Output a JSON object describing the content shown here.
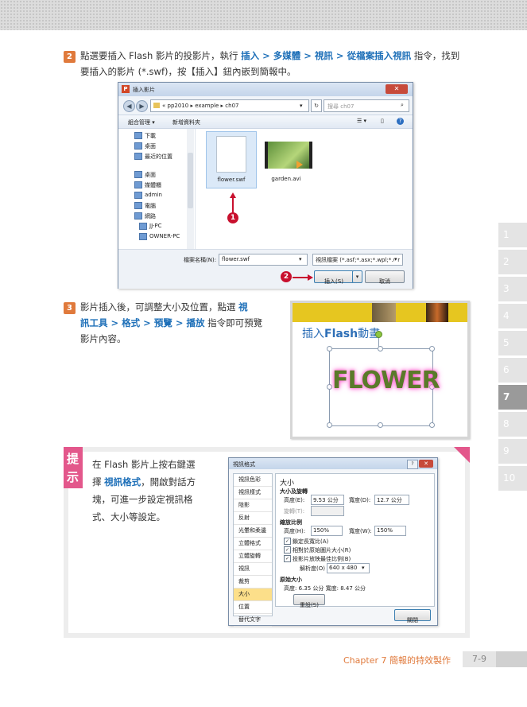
{
  "step2": {
    "number": "2",
    "t1": "點選要插入 Flash 影片的投影片，執行 ",
    "k1": "插入",
    "sep1": " > ",
    "k2": "多媒體",
    "sep2": " > ",
    "k3": "視訊",
    "sep3": " > ",
    "k4": "從檔案插入視訊",
    "t2": " 指令，找到",
    "line2": "要插入的影片 (*.swf)，按【插入】鈕內嵌到簡報中。"
  },
  "dialog": {
    "title": "插入影片",
    "path": [
      "« pp2010",
      "example",
      "ch07"
    ],
    "search_placeholder": "搜尋 ch07",
    "organize": "組合管理 ▾",
    "new_folder": "新增資料夾",
    "nav": [
      {
        "label": "下載",
        "icon": "download-folder-icon"
      },
      {
        "label": "桌面",
        "icon": "desktop-icon"
      },
      {
        "label": "最近的位置",
        "icon": "recent-places-icon"
      },
      {
        "label": "桌面",
        "icon": "desktop-icon"
      },
      {
        "label": "媒體櫃",
        "icon": "library-icon"
      },
      {
        "label": "admin",
        "icon": "user-icon"
      },
      {
        "label": "電腦",
        "icon": "computer-icon"
      },
      {
        "label": "網路",
        "icon": "network-icon"
      },
      {
        "label": "JJ-PC",
        "icon": "pc-icon"
      },
      {
        "label": "OWNER-PC",
        "icon": "pc-icon"
      }
    ],
    "files": [
      {
        "name": "flower.swf",
        "icon": "blank-file-icon"
      },
      {
        "name": "garden.avi",
        "icon": "video-thumbnail-icon"
      }
    ],
    "filename_label": "檔案名稱(N):",
    "filename_value": "flower.swf",
    "filetype_value": "視訊檔案 (*.asf;*.asx;*.wpl;*.wr",
    "insert_btn": "插入(S)",
    "cancel_btn": "取消",
    "markers": [
      "1",
      "2"
    ]
  },
  "step3": {
    "number": "3",
    "t1": "影片插入後，可調整大小及位置，點選 ",
    "k1": "視",
    "k2": "訊工具",
    "sep1": " > ",
    "k3": "格式",
    "sep2": " > ",
    "k4": "預覽",
    "sep3": " > ",
    "k5": "播放",
    "t2": " 指令即可預覽",
    "line3": "影片內容。"
  },
  "slide": {
    "title_a": "插入",
    "title_b": "Flash",
    "title_c": "動畫",
    "flower": "FLOWER"
  },
  "tip": {
    "label_a": "提",
    "label_b": "示",
    "l1": "在 Flash 影片上按右鍵選",
    "l2a": "擇 ",
    "l2k": "視訊格式",
    "l2b": "，開啟對話方",
    "l3": "塊，可進一步設定視訊格",
    "l4": "式、大小等設定。"
  },
  "format": {
    "title": "視訊格式",
    "list": [
      "視訊色彩",
      "視訊樣式",
      "陰影",
      "反射",
      "光暈和柔邊",
      "立體格式",
      "立體旋轉",
      "視訊",
      "裁剪",
      "大小",
      "位置",
      "替代文字"
    ],
    "selected_index": 9,
    "heading": "大小",
    "grp1": "大小及旋轉",
    "h_label": "高度(E):",
    "h_value": "9.53 公分",
    "w_label": "寬度(D):",
    "w_value": "12.7 公分",
    "rot_label": "旋轉(T):",
    "grp2": "縮放比例",
    "sh_label": "高度(H):",
    "sh_value": "150%",
    "sw_label": "寬度(W):",
    "sw_value": "150%",
    "c1": "鎖定長寬比(A)",
    "c2": "相對於原始圖片大小(R)",
    "c3": "投影片放映最佳比例(B)",
    "res_label": "解析度(O)",
    "res_value": "640 x 480",
    "grp3": "原始大小",
    "orig": "高度:  6.35 公分   寬度:  8.47 公分",
    "reset": "重設(S)",
    "close": "關閉"
  },
  "side_tabs": [
    "1",
    "2",
    "3",
    "4",
    "5",
    "6",
    "7",
    "8",
    "9",
    "10"
  ],
  "active_tab": "7",
  "footer": {
    "chapter": "Chapter 7  簡報的特效製作",
    "page": "7-9"
  }
}
